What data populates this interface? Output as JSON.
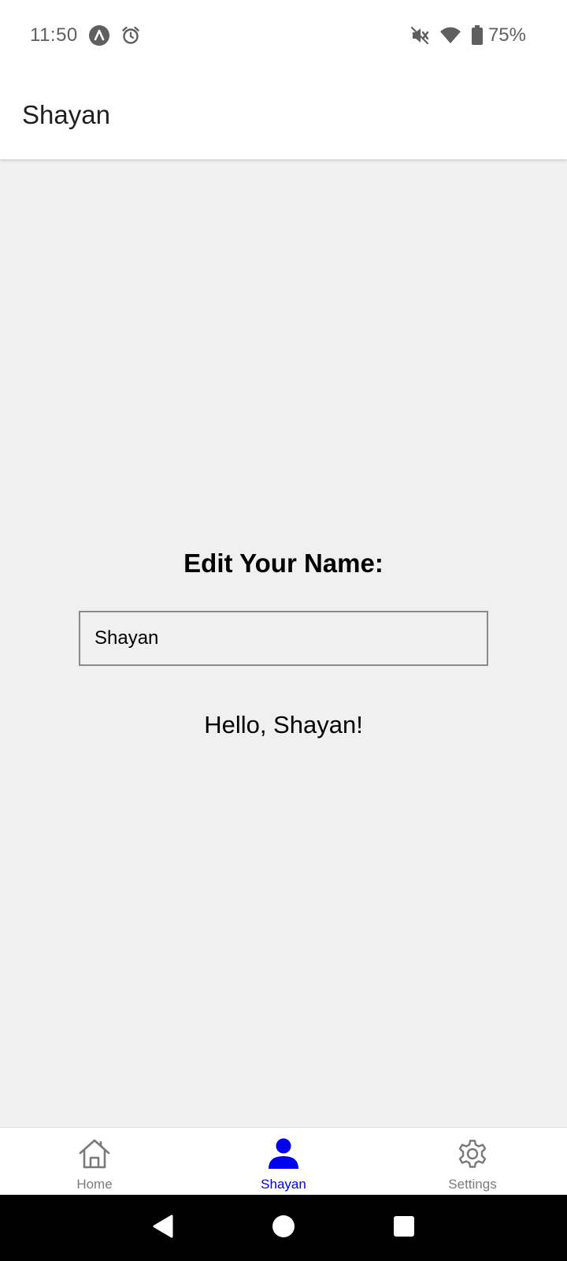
{
  "status_bar": {
    "time": "11:50",
    "battery_percent": "75%"
  },
  "app_bar": {
    "title": "Shayan"
  },
  "main": {
    "heading": "Edit Your Name:",
    "name_input_value": "Shayan",
    "greeting": "Hello, Shayan!"
  },
  "tabs": [
    {
      "label": "Home",
      "icon": "home-icon",
      "active": false
    },
    {
      "label": "Shayan",
      "icon": "person-icon",
      "active": true
    },
    {
      "label": "Settings",
      "icon": "gear-icon",
      "active": false
    }
  ],
  "colors": {
    "active_tab": "#0000ee",
    "inactive_tab": "#7a7a7a",
    "background": "#f0f0f0"
  }
}
